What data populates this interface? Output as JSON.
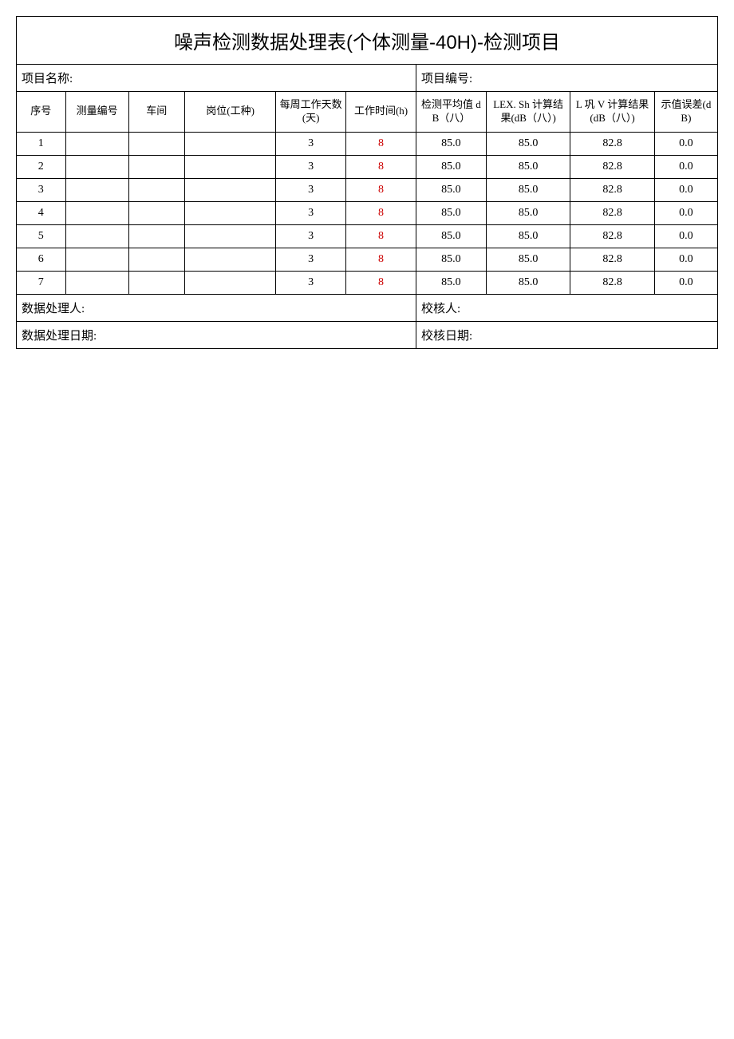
{
  "title": "噪声检测数据处理表(个体测量-40H)-检测项目",
  "labels": {
    "projectName": "项目名称:",
    "projectNumber": "项目编号:",
    "processor": "数据处理人:",
    "checker": "校核人:",
    "processDate": "数据处理日期:",
    "checkDate": "校核日期:"
  },
  "headers": {
    "seq": "序号",
    "measureNo": "测量编号",
    "workshop": "车间",
    "post": "岗位(工种)",
    "daysPerWeek": "每周工作天数(天)",
    "workHours": "工作时间(h)",
    "avgDb": "检测平均值 dB（八）",
    "lexSh": "LEX. Sh 计算结果(dB（八）)",
    "lwV": "L 巩 V 计算结果(dB（八）)",
    "deviation": "示值误差(dB)"
  },
  "rows": [
    {
      "seq": "1",
      "measureNo": "",
      "workshop": "",
      "post": "",
      "days": "3",
      "hours": "8",
      "avg": "85.0",
      "lex": "85.0",
      "lwv": "82.8",
      "dev": "0.0"
    },
    {
      "seq": "2",
      "measureNo": "",
      "workshop": "",
      "post": "",
      "days": "3",
      "hours": "8",
      "avg": "85.0",
      "lex": "85.0",
      "lwv": "82.8",
      "dev": "0.0"
    },
    {
      "seq": "3",
      "measureNo": "",
      "workshop": "",
      "post": "",
      "days": "3",
      "hours": "8",
      "avg": "85.0",
      "lex": "85.0",
      "lwv": "82.8",
      "dev": "0.0"
    },
    {
      "seq": "4",
      "measureNo": "",
      "workshop": "",
      "post": "",
      "days": "3",
      "hours": "8",
      "avg": "85.0",
      "lex": "85.0",
      "lwv": "82.8",
      "dev": "0.0"
    },
    {
      "seq": "5",
      "measureNo": "",
      "workshop": "",
      "post": "",
      "days": "3",
      "hours": "8",
      "avg": "85.0",
      "lex": "85.0",
      "lwv": "82.8",
      "dev": "0.0"
    },
    {
      "seq": "6",
      "measureNo": "",
      "workshop": "",
      "post": "",
      "days": "3",
      "hours": "8",
      "avg": "85.0",
      "lex": "85.0",
      "lwv": "82.8",
      "dev": "0.0"
    },
    {
      "seq": "7",
      "measureNo": "",
      "workshop": "",
      "post": "",
      "days": "3",
      "hours": "8",
      "avg": "85.0",
      "lex": "85.0",
      "lwv": "82.8",
      "dev": "0.0"
    }
  ]
}
